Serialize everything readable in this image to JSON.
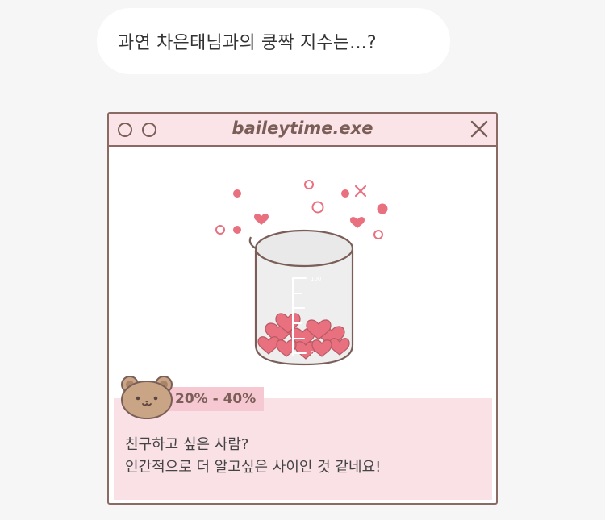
{
  "chat": {
    "message": "과연 차은태님과의 쿵짝 지수는...?"
  },
  "window": {
    "title": "baileytime.exe",
    "buttons": [
      "circle-button",
      "circle-button",
      "close-icon"
    ]
  },
  "result": {
    "range": "20% - 40%",
    "line1": "친구하고 싶은 사람?",
    "line2": "인간적으로 더 알고싶은 사이인 것 같네요!"
  },
  "beaker": {
    "max_label": "100",
    "min_label": "0"
  },
  "colors": {
    "background": "#f6f6f6",
    "titlebar": "#fbe4e8",
    "panel": "#f9e1e6",
    "tag": "#f6c9d2",
    "accent": "#e8707f",
    "border": "#8a6a62"
  },
  "icons": [
    "circle-icon",
    "close-icon",
    "heart-icon",
    "beaker-icon",
    "bear-icon"
  ]
}
